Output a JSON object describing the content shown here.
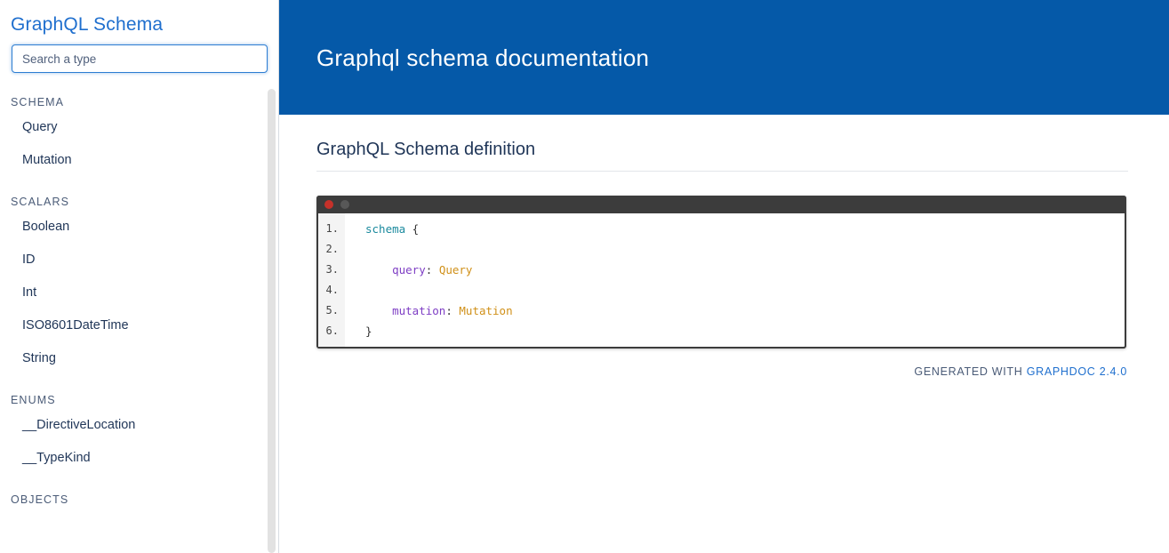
{
  "sidebar": {
    "title": "GraphQL Schema",
    "search": {
      "placeholder": "Search a type",
      "value": ""
    },
    "sections": [
      {
        "label": "SCHEMA",
        "items": [
          "Query",
          "Mutation"
        ]
      },
      {
        "label": "SCALARS",
        "items": [
          "Boolean",
          "ID",
          "Int",
          "ISO8601DateTime",
          "String"
        ]
      },
      {
        "label": "ENUMS",
        "items": [
          "__DirectiveLocation",
          "__TypeKind"
        ]
      },
      {
        "label": "OBJECTS",
        "items": []
      }
    ]
  },
  "header": {
    "title": "Graphql schema documentation",
    "background_color": "#0559a8"
  },
  "main": {
    "section_title": "GraphQL Schema definition",
    "code": {
      "line_numbers": [
        "1.",
        "2.",
        "3.",
        "4.",
        "5.",
        "6."
      ],
      "lines": [
        {
          "n": "1.",
          "kw": "schema",
          "punc": " {",
          "field": "",
          "type": "",
          "indent": ""
        },
        {
          "n": "2.",
          "kw": "",
          "punc": "",
          "field": "",
          "type": "",
          "indent": ""
        },
        {
          "n": "3.",
          "kw": "",
          "punc": ": ",
          "field": "query",
          "type": "Query",
          "indent": "    "
        },
        {
          "n": "4.",
          "kw": "",
          "punc": "",
          "field": "",
          "type": "",
          "indent": ""
        },
        {
          "n": "5.",
          "kw": "",
          "punc": ": ",
          "field": "mutation",
          "type": "Mutation",
          "indent": "    "
        },
        {
          "n": "6.",
          "kw": "",
          "punc": "}",
          "field": "",
          "type": "",
          "indent": ""
        }
      ],
      "titlebar_dots": [
        "close-red",
        "minimize-gray"
      ],
      "syntax_colors": {
        "keyword": "#1b8a9e",
        "field": "#7e3ec4",
        "type": "#d09018",
        "punctuation": "#333333"
      }
    }
  },
  "footer": {
    "generated_with": "GENERATED WITH",
    "link_label": "GRAPHDOC 2.4.0",
    "link_color": "#1f6fce"
  }
}
